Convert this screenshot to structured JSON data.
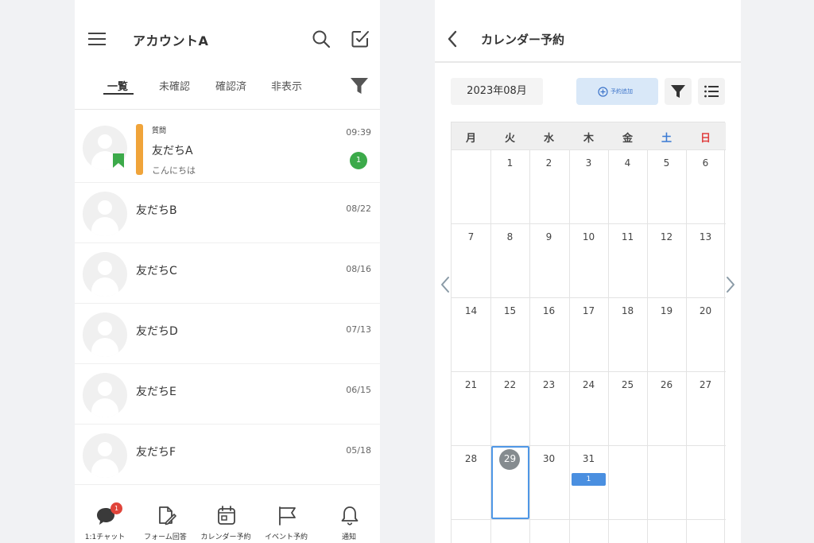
{
  "left_screen": {
    "header": {
      "account_name": "アカウントA",
      "menu_icon": "menu-icon",
      "search_icon": "search-icon",
      "compose_icon": "compose-icon"
    },
    "tabs": [
      {
        "label": "一覧",
        "active": true
      },
      {
        "label": "未確認",
        "active": false
      },
      {
        "label": "確認済",
        "active": false
      },
      {
        "label": "非表示",
        "active": false
      }
    ],
    "filter_icon": "filter-icon",
    "chats": [
      {
        "tag": "質問",
        "name": "友だちA",
        "preview": "こんにちは",
        "time": "09:39",
        "unread": "1",
        "accent_color": "#f0a43a",
        "bookmarked": true
      },
      {
        "name": "友だちB",
        "time": "08/22"
      },
      {
        "name": "友だちC",
        "time": "08/16"
      },
      {
        "name": "友だちD",
        "time": "07/13"
      },
      {
        "name": "友だちE",
        "time": "06/15"
      },
      {
        "name": "友だちF",
        "time": "05/18"
      }
    ],
    "bottom_nav": [
      {
        "label": "1:1チャット",
        "icon": "chat-bubble-icon",
        "badge": "1"
      },
      {
        "label": "フォーム回答",
        "icon": "form-edit-icon"
      },
      {
        "label": "カレンダー予約",
        "icon": "calendar-icon"
      },
      {
        "label": "イベント予約",
        "icon": "flag-icon"
      },
      {
        "label": "通知",
        "icon": "bell-icon"
      }
    ]
  },
  "right_screen": {
    "header": {
      "title": "カレンダー予約",
      "back_icon": "back-chevron-icon"
    },
    "month": "2023年08月",
    "add_button_label": "予約追加",
    "weekdays": [
      "月",
      "火",
      "水",
      "木",
      "金",
      "土",
      "日"
    ],
    "weeks": [
      [
        "",
        "1",
        "2",
        "3",
        "4",
        "5",
        "6"
      ],
      [
        "7",
        "8",
        "9",
        "10",
        "11",
        "12",
        "13"
      ],
      [
        "14",
        "15",
        "16",
        "17",
        "18",
        "19",
        "20"
      ],
      [
        "21",
        "22",
        "23",
        "24",
        "25",
        "26",
        "27"
      ],
      [
        "28",
        "29",
        "30",
        "31",
        "",
        "",
        ""
      ]
    ],
    "today": "29",
    "event_count_31": "1",
    "colors": {
      "saturday": "#3b7bd4",
      "sunday": "#e04040",
      "today_frame": "#4f97e6",
      "event": "#4a8fe0",
      "accent_orange": "#f0a43a",
      "unread_green": "#3caa4a",
      "badge_red": "#e0443a"
    }
  }
}
